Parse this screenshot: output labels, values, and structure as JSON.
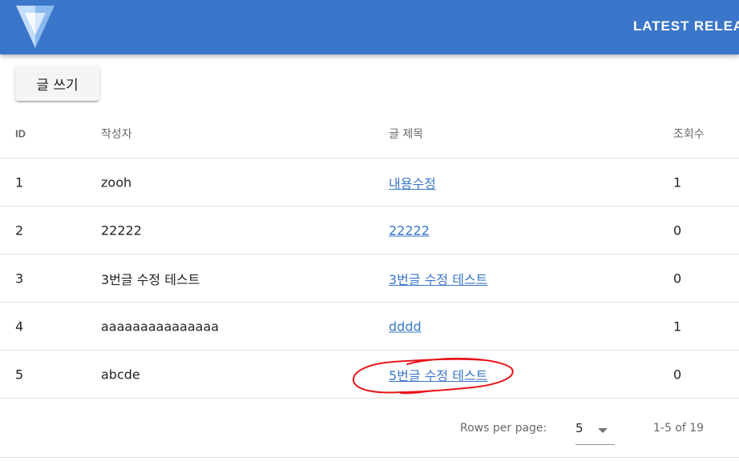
{
  "app_bar": {
    "nav_link": "LATEST RELEA",
    "color": "#3a76c9",
    "logo_icon": "vuetify-logo-icon"
  },
  "toolbar": {
    "write_button_label": "글 쓰기"
  },
  "table": {
    "headers": {
      "id": "ID",
      "author": "작성자",
      "title": "글 제목",
      "views": "조회수"
    },
    "rows": [
      {
        "id": "1",
        "author": "zooh",
        "title": "내용수정",
        "views": "1"
      },
      {
        "id": "2",
        "author": "22222",
        "title": "22222",
        "views": "0"
      },
      {
        "id": "3",
        "author": "3번글 수정 테스트",
        "title": "3번글 수정 테스트",
        "views": "0"
      },
      {
        "id": "4",
        "author": "aaaaaaaaaaaaaaa",
        "title": "dddd",
        "views": "1"
      },
      {
        "id": "5",
        "author": "abcde",
        "title": "5번글 수정 테스트",
        "views": "0"
      }
    ],
    "link_color": "#3a76c9"
  },
  "footer": {
    "rows_per_page_label": "Rows per page:",
    "rows_per_page_value": "5",
    "page_info": "1-5 of 19"
  },
  "annotation": {
    "color": "#e8141b",
    "shape": "hand-drawn-ellipse"
  }
}
